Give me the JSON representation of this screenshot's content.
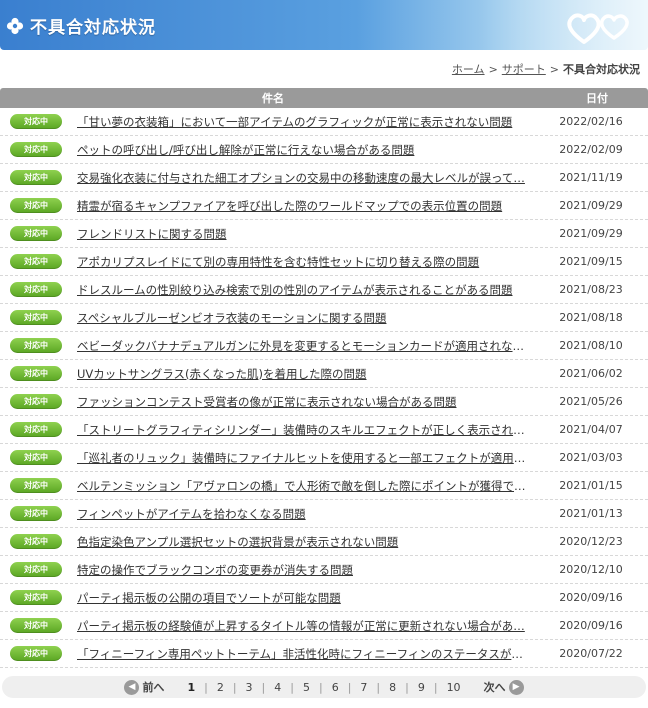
{
  "header": {
    "title": "不具合対応状況",
    "accent": "#3a7fcf"
  },
  "breadcrumb": {
    "home": "ホーム",
    "support": "サポート",
    "current": "不具合対応状況",
    "sep": ">"
  },
  "table": {
    "col_title": "件名",
    "col_date": "日付",
    "badge_color": "#6cba33",
    "rows": [
      {
        "status": "対応中",
        "title": "「甘い夢の衣装箱」において一部アイテムのグラフィックが正常に表示されない問題",
        "date": "2022/02/16"
      },
      {
        "status": "対応中",
        "title": "ペットの呼び出し/呼び出し解除が正常に行えない場合がある問題",
        "date": "2022/02/09"
      },
      {
        "status": "対応中",
        "title": "交易強化衣装に付与された細工オプションの交易中の移動速度の最大レベルが誤って…",
        "date": "2021/11/19"
      },
      {
        "status": "対応中",
        "title": "精霊が宿るキャンプファイアを呼び出した際のワールドマップでの表示位置の問題",
        "date": "2021/09/29"
      },
      {
        "status": "対応中",
        "title": "フレンドリストに関する問題",
        "date": "2021/09/29"
      },
      {
        "status": "対応中",
        "title": "アポカリプスレイドにて別の専用特性を含む特性セットに切り替える際の問題",
        "date": "2021/09/15"
      },
      {
        "status": "対応中",
        "title": "ドレスルームの性別絞り込み検索で別の性別のアイテムが表示されることがある問題",
        "date": "2021/08/23"
      },
      {
        "status": "対応中",
        "title": "スペシャルブルーゼンビオラ衣装のモーションに関する問題",
        "date": "2021/08/18"
      },
      {
        "status": "対応中",
        "title": "ベビーダックバナナデュアルガンに外見を変更するとモーションカードが適用されない問…",
        "date": "2021/08/10"
      },
      {
        "status": "対応中",
        "title": "UVカットサングラス(赤くなった肌)を着用した際の問題",
        "date": "2021/06/02"
      },
      {
        "status": "対応中",
        "title": "ファッションコンテスト受賞者の像が正常に表示されない場合がある問題",
        "date": "2021/05/26"
      },
      {
        "status": "対応中",
        "title": "「ストリートグラフィティシリンダー」装備時のスキルエフェクトが正しく表示されない問題",
        "date": "2021/04/07"
      },
      {
        "status": "対応中",
        "title": "「巡礼者のリュック」装備時にファイナルヒットを使用すると一部エフェクトが適用されな…",
        "date": "2021/03/03"
      },
      {
        "status": "対応中",
        "title": "ベルテンミッション「アヴァロンの橋」で人形術で敵を倒した際にポイントが獲得できない…",
        "date": "2021/01/15"
      },
      {
        "status": "対応中",
        "title": "フィンペットがアイテムを拾わなくなる問題",
        "date": "2021/01/13"
      },
      {
        "status": "対応中",
        "title": "色指定染色アンプル選択セットの選択背景が表示されない問題",
        "date": "2020/12/23"
      },
      {
        "status": "対応中",
        "title": "特定の操作でブラックコンボの変更券が消失する問題",
        "date": "2020/12/10"
      },
      {
        "status": "対応中",
        "title": "パーティ掲示板の公開の項目でソートが可能な問題",
        "date": "2020/09/16"
      },
      {
        "status": "対応中",
        "title": "パーティ掲示板の経験値が上昇するタイトル等の情報が正常に更新されない場合があ…",
        "date": "2020/09/16"
      },
      {
        "status": "対応中",
        "title": "「フィニーフィン専用ペットトーテム」非活性化時にフィニーフィンのステータスが大幅に…",
        "date": "2020/07/22"
      }
    ]
  },
  "pager": {
    "prev": "前へ",
    "next": "次へ",
    "current": "1",
    "pages": [
      "1",
      "2",
      "3",
      "4",
      "5",
      "6",
      "7",
      "8",
      "9",
      "10"
    ]
  }
}
